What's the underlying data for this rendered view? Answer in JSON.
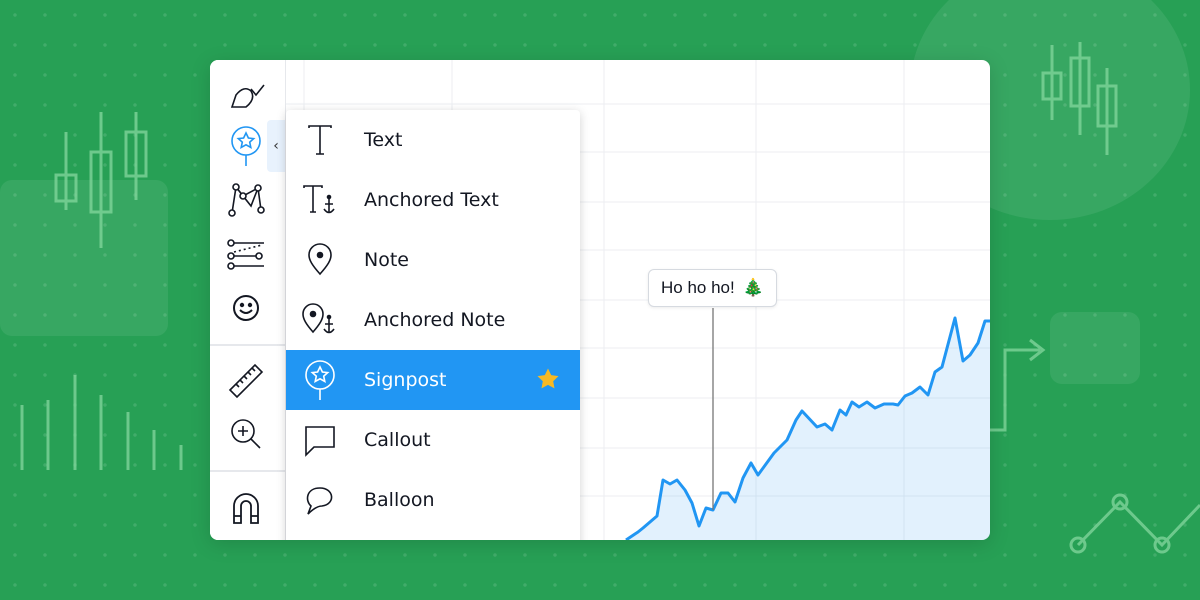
{
  "toolbar": {
    "items": [
      {
        "icon": "brush-icon"
      },
      {
        "icon": "signpost-icon",
        "active": true
      },
      {
        "icon": "pattern-icon"
      },
      {
        "icon": "prediction-icon"
      },
      {
        "icon": "emoji-icon"
      },
      {
        "icon": "ruler-icon"
      },
      {
        "icon": "zoom-in-icon"
      },
      {
        "icon": "magnet-icon"
      }
    ],
    "collapse": "‹"
  },
  "menu": {
    "items": [
      {
        "label": "Text",
        "icon": "text-icon"
      },
      {
        "label": "Anchored Text",
        "icon": "anchored-text-icon"
      },
      {
        "label": "Note",
        "icon": "note-icon"
      },
      {
        "label": "Anchored Note",
        "icon": "anchored-note-icon"
      },
      {
        "label": "Signpost",
        "icon": "signpost-icon",
        "selected": true,
        "favorite": true
      },
      {
        "label": "Callout",
        "icon": "callout-icon"
      },
      {
        "label": "Balloon",
        "icon": "balloon-icon"
      }
    ]
  },
  "signpost": {
    "text": "Ho ho ho!",
    "emoji": "🎄"
  },
  "colors": {
    "accent": "#2196f3",
    "background": "#27a055",
    "star": "#f7b924"
  }
}
